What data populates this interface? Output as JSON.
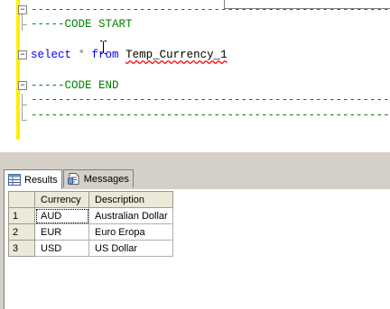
{
  "editor": {
    "lines": {
      "dash1": "---------------------------------------------------------",
      "code_start": "-----CODE START",
      "select_kw": "select",
      "star": " * ",
      "from_kw": "from",
      "space": " ",
      "table_name": "Temp_Currency_1",
      "code_end": "-----CODE END",
      "dash2": "---------------------------------------------------------",
      "dash3": "---------------------------------------------------------"
    },
    "collapse_symbol": "−",
    "colors": {
      "comment": "#008000",
      "keyword": "#0000ff",
      "change_bar": "#ffee00"
    }
  },
  "results_tabs": [
    {
      "label": "Results",
      "icon": "grid-icon",
      "active": true
    },
    {
      "label": "Messages",
      "icon": "messages-icon",
      "active": false
    }
  ],
  "grid": {
    "columns": [
      "Currency",
      "Description"
    ],
    "rows": [
      {
        "num": "1",
        "currency": "AUD",
        "description": "Australian Dollar"
      },
      {
        "num": "2",
        "currency": "EUR",
        "description": "Euro Eropa"
      },
      {
        "num": "3",
        "currency": "USD",
        "description": "US Dollar"
      }
    ]
  }
}
